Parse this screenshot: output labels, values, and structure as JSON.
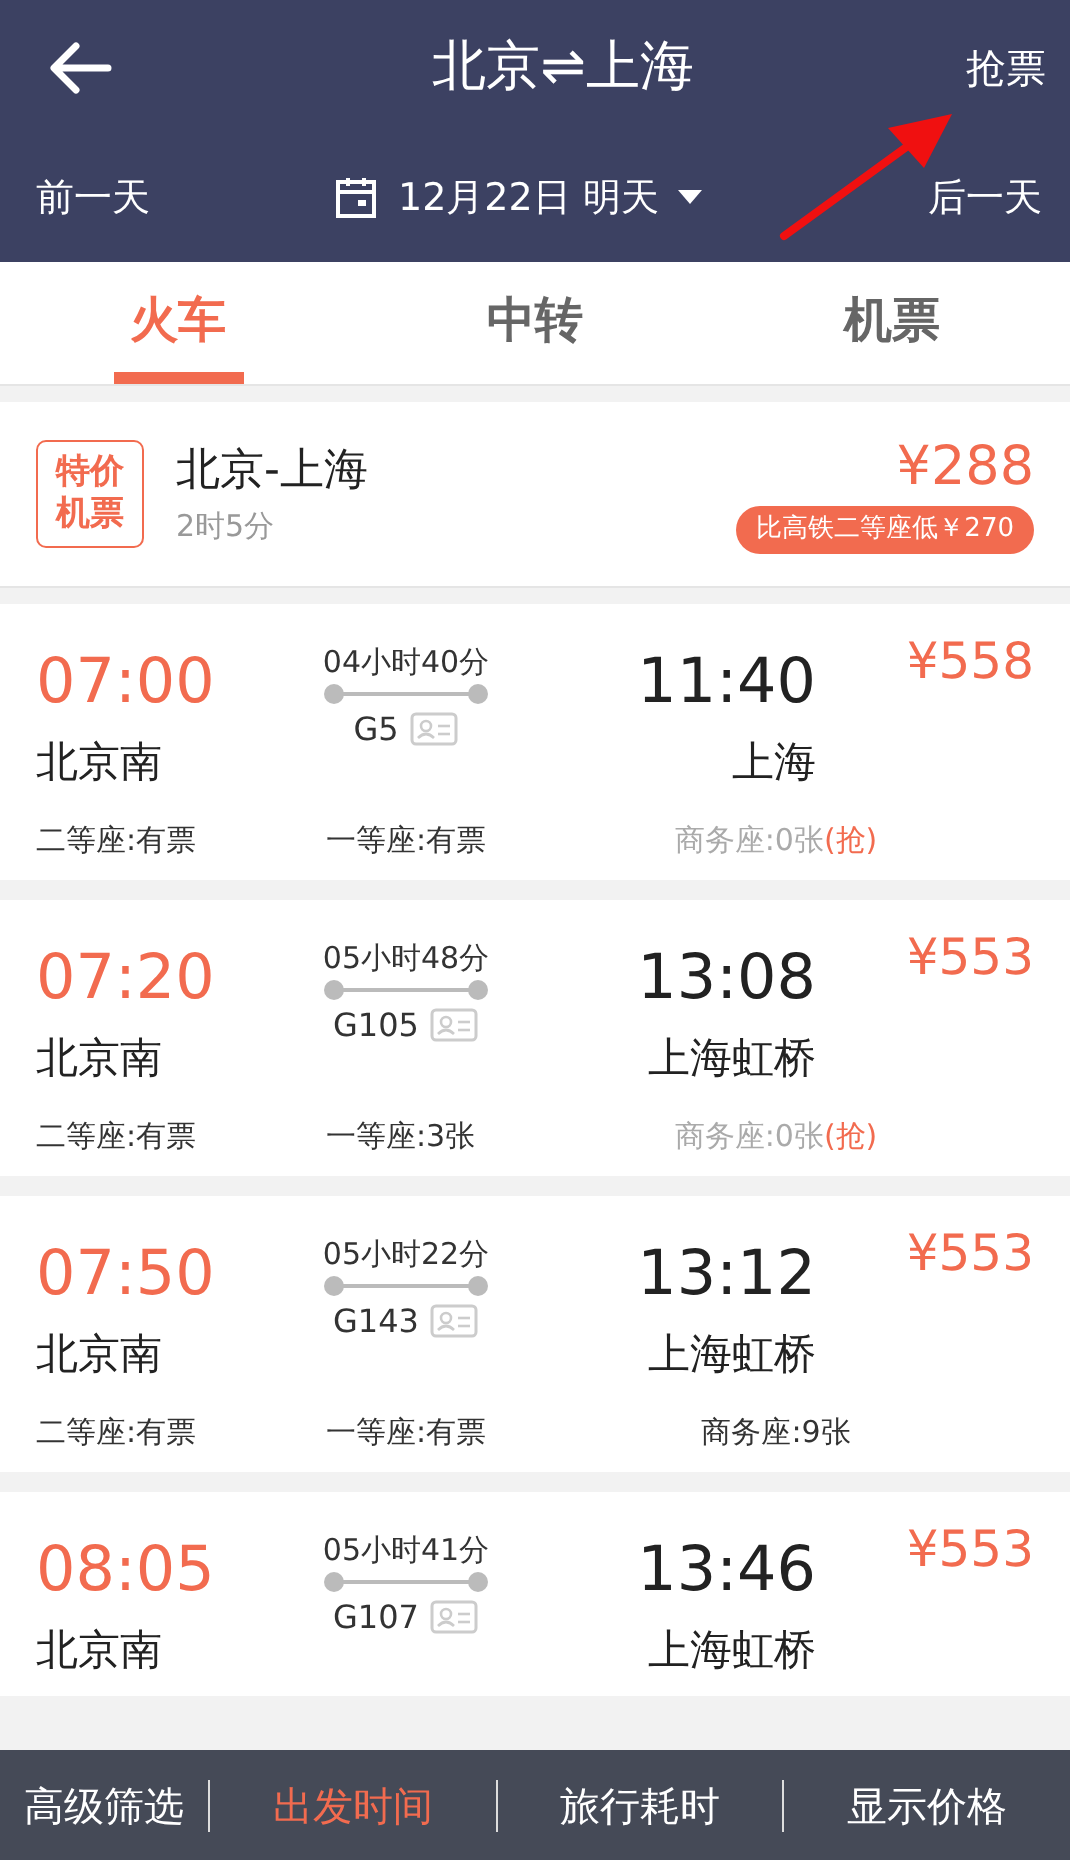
{
  "header": {
    "title": "北京⇌上海",
    "grab_link": "抢票",
    "prev_day": "前一天",
    "date": "12月22日 明天",
    "next_day": "后一天"
  },
  "tabs": [
    {
      "label": "火车",
      "selected": true
    },
    {
      "label": "中转",
      "selected": false
    },
    {
      "label": "机票",
      "selected": false
    }
  ],
  "flight_offer": {
    "badge": "特价机票",
    "route": "北京-上海",
    "duration": "2时5分",
    "price": "¥288",
    "saving": "比高铁二等座低￥270"
  },
  "trains": [
    {
      "depart": "07:00",
      "duration": "04小时40分",
      "arrive": "11:40",
      "price": "¥558",
      "from": "北京南",
      "number": "G5",
      "to": "上海",
      "seats": [
        {
          "text": "二等座:有票",
          "sold_out": false
        },
        {
          "text": "一等座:有票",
          "sold_out": false
        },
        {
          "text": "商务座:0张",
          "sold_out": true,
          "grab": "(抢)"
        }
      ]
    },
    {
      "depart": "07:20",
      "duration": "05小时48分",
      "arrive": "13:08",
      "price": "¥553",
      "from": "北京南",
      "number": "G105",
      "to": "上海虹桥",
      "seats": [
        {
          "text": "二等座:有票",
          "sold_out": false
        },
        {
          "text": "一等座:3张",
          "sold_out": false
        },
        {
          "text": "商务座:0张",
          "sold_out": true,
          "grab": "(抢)"
        }
      ]
    },
    {
      "depart": "07:50",
      "duration": "05小时22分",
      "arrive": "13:12",
      "price": "¥553",
      "from": "北京南",
      "number": "G143",
      "to": "上海虹桥",
      "seats": [
        {
          "text": "二等座:有票",
          "sold_out": false
        },
        {
          "text": "一等座:有票",
          "sold_out": false
        },
        {
          "text": "商务座:9张",
          "sold_out": false
        }
      ]
    },
    {
      "depart": "08:05",
      "duration": "05小时41分",
      "arrive": "13:46",
      "price": "¥553",
      "from": "北京南",
      "number": "G107",
      "to": "上海虹桥"
    }
  ],
  "bottom_bar": [
    {
      "label": "高级筛选",
      "selected": false
    },
    {
      "label": "出发时间",
      "selected": true
    },
    {
      "label": "旅行耗时",
      "selected": false
    },
    {
      "label": "显示价格",
      "selected": false
    }
  ]
}
